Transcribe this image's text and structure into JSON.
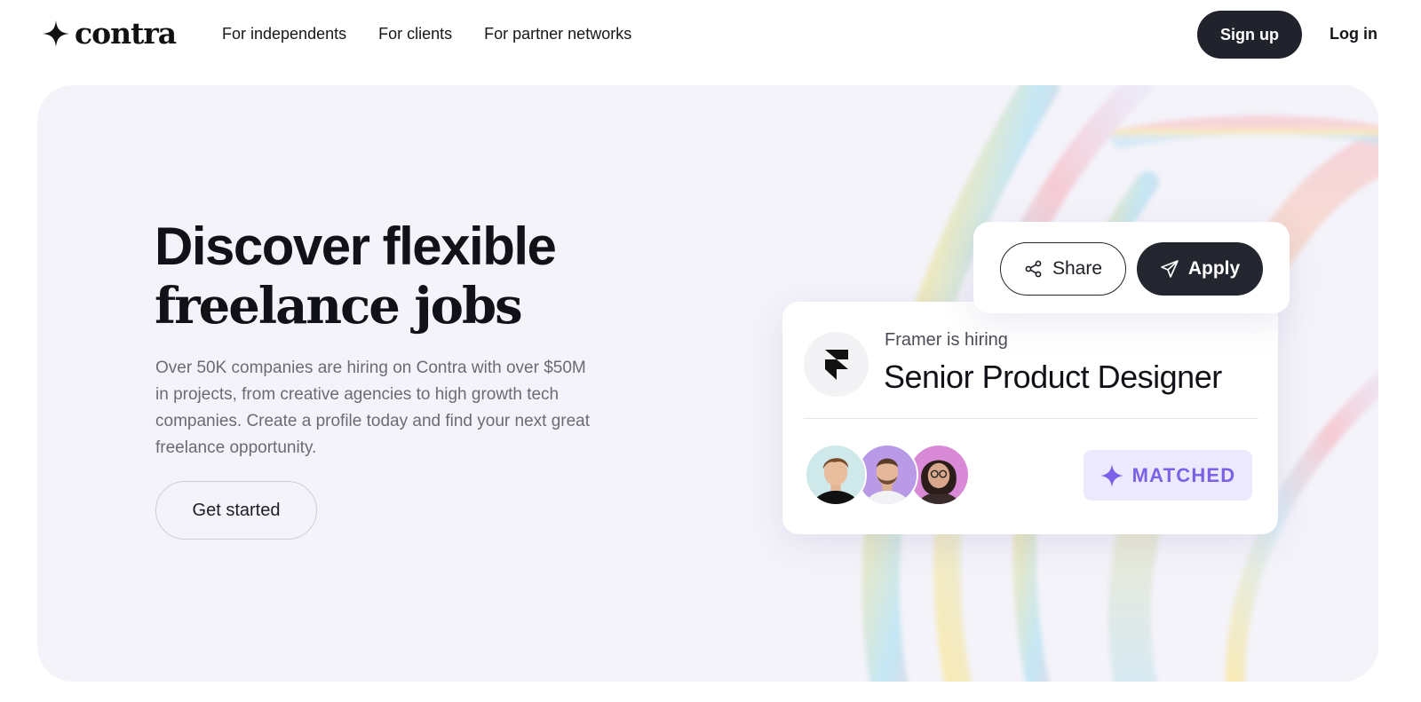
{
  "brand": {
    "name": "contra",
    "logo_icon": "four-point-star-icon"
  },
  "nav": {
    "links": [
      "For independents",
      "For clients",
      "For partner networks"
    ],
    "signup_label": "Sign up",
    "login_label": "Log in"
  },
  "hero": {
    "title_line1": "Discover flexible",
    "title_line2": "freelance jobs",
    "description": "Over 50K companies are hiring on Contra with over $50M in projects, from creative agencies to high growth tech companies. Create a profile today and find your next great freelance opportunity.",
    "cta_label": "Get started"
  },
  "job_card": {
    "company_logo_icon": "framer-logo-icon",
    "hiring_text": "Framer is hiring",
    "job_title": "Senior Product Designer",
    "matched_label": "MATCHED",
    "matched_icon": "sparkle-icon",
    "avatar_count": 3
  },
  "actions": {
    "share_label": "Share",
    "share_icon": "share-icon",
    "apply_label": "Apply",
    "apply_icon": "paper-plane-icon"
  },
  "colors": {
    "dark_button": "#20222c",
    "hero_background": "#f4f3fa",
    "matched_accent": "#7b61e6",
    "matched_background": "#ede9fd"
  }
}
